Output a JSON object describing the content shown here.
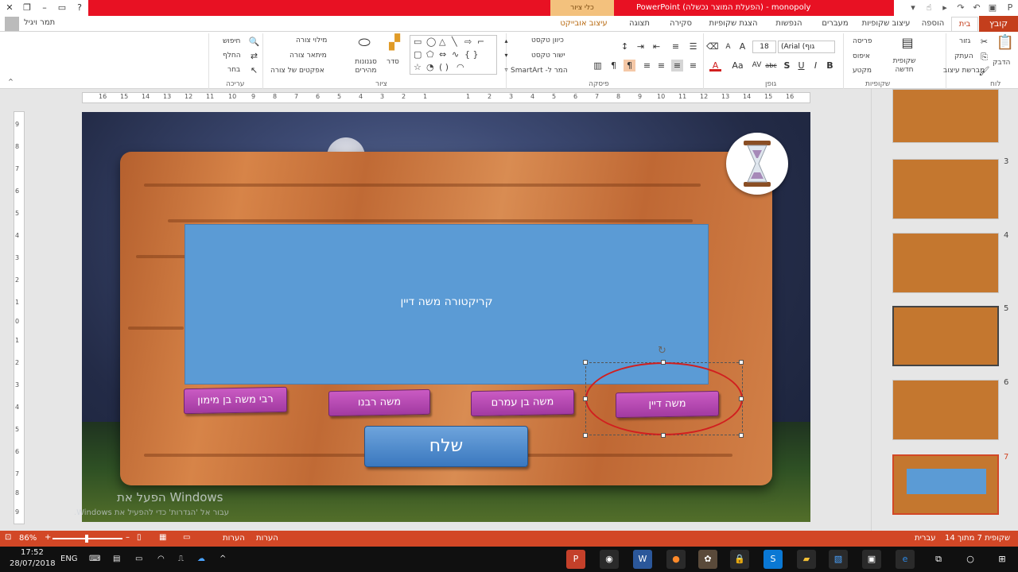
{
  "window": {
    "title": "monopoly - (הפעלת המוצר נכשלה) PowerPoint",
    "context_group": "כלי ציור",
    "help": "?"
  },
  "user": {
    "name": "תמר ויגיל"
  },
  "tabs": [
    "קובץ",
    "בית",
    "הוספה",
    "עיצוב שקופיות",
    "מעברים",
    "הנפשות",
    "הצגת שקופיות",
    "סקירה",
    "תצוגה",
    "עיצוב אובייקט"
  ],
  "ribbon": {
    "clipboard": {
      "label": "לוח",
      "paste": "הדבק",
      "cut": "גזור",
      "copy": "העתק",
      "format_painter": "מברשת עיצוב"
    },
    "slides": {
      "label": "שקופיות",
      "new_slide": "שקופית חדשה",
      "layout": "פריסה",
      "reset": "איפוס",
      "section": "מקטע"
    },
    "font": {
      "label": "גופן",
      "name": "(Arial (גוף",
      "size": "18",
      "bold": "B",
      "italic": "I",
      "underline": "U",
      "strike": "S",
      "shadow": "abc"
    },
    "paragraph": {
      "label": "פיסקה",
      "text_direction": "כיוון טקסט",
      "align_text": "ישור טקסט",
      "smartart": "SmartArt -המר ל"
    },
    "drawing": {
      "label": "ציור",
      "arrange": "סדר",
      "quick_styles": "סגנונות מהירים",
      "fill": "מילוי צורה",
      "outline": "מיתאר צורה",
      "effects": "אפקטים של צורה"
    },
    "editing": {
      "label": "עריכה",
      "find": "חיפוש",
      "replace": "החלף",
      "select": "בחר"
    }
  },
  "ruler": [
    "16",
    "15",
    "14",
    "13",
    "12",
    "11",
    "10",
    "9",
    "8",
    "7",
    "6",
    "5",
    "4",
    "3",
    "2",
    "1",
    "1",
    "2",
    "3",
    "4",
    "5",
    "6",
    "7",
    "8",
    "9",
    "10",
    "11",
    "12",
    "13",
    "14",
    "15",
    "16"
  ],
  "vruler": [
    "9",
    "8",
    "7",
    "6",
    "5",
    "4",
    "3",
    "2",
    "1",
    "0",
    "1",
    "2",
    "3",
    "4",
    "5",
    "6",
    "7",
    "8",
    "9"
  ],
  "slide": {
    "blue_box_text": "קריקטורה משה דיין",
    "answers": [
      "רבי משה בן מימון",
      "משה רבנו",
      "משה בן עמרם",
      "משה דיין"
    ],
    "send_button": "שלח",
    "hourglass_icon": "hourglass-icon"
  },
  "watermark": {
    "line1": "הפעל את Windows",
    "line2": "עבור אל 'הגדרות' כדי להפעיל את Windows."
  },
  "thumbnails": {
    "numbers": [
      "3",
      "4",
      "5",
      "6",
      "7"
    ],
    "selected": "7"
  },
  "status": {
    "slide_info": "שקופית 7 מתוך 14",
    "language": "עברית",
    "notes": "הערות",
    "comments": "הערות",
    "zoom": "86%"
  },
  "taskbar": {
    "time": "17:52",
    "date": "28/07/2018",
    "lang": "ENG"
  },
  "colors": {
    "accent": "#d24726",
    "title_red": "#e81123",
    "blue_box": "#5b9bd5",
    "answer_purple": "#b447b2",
    "send_blue": "#4f8fd0",
    "selection_red": "#d11f1f"
  }
}
